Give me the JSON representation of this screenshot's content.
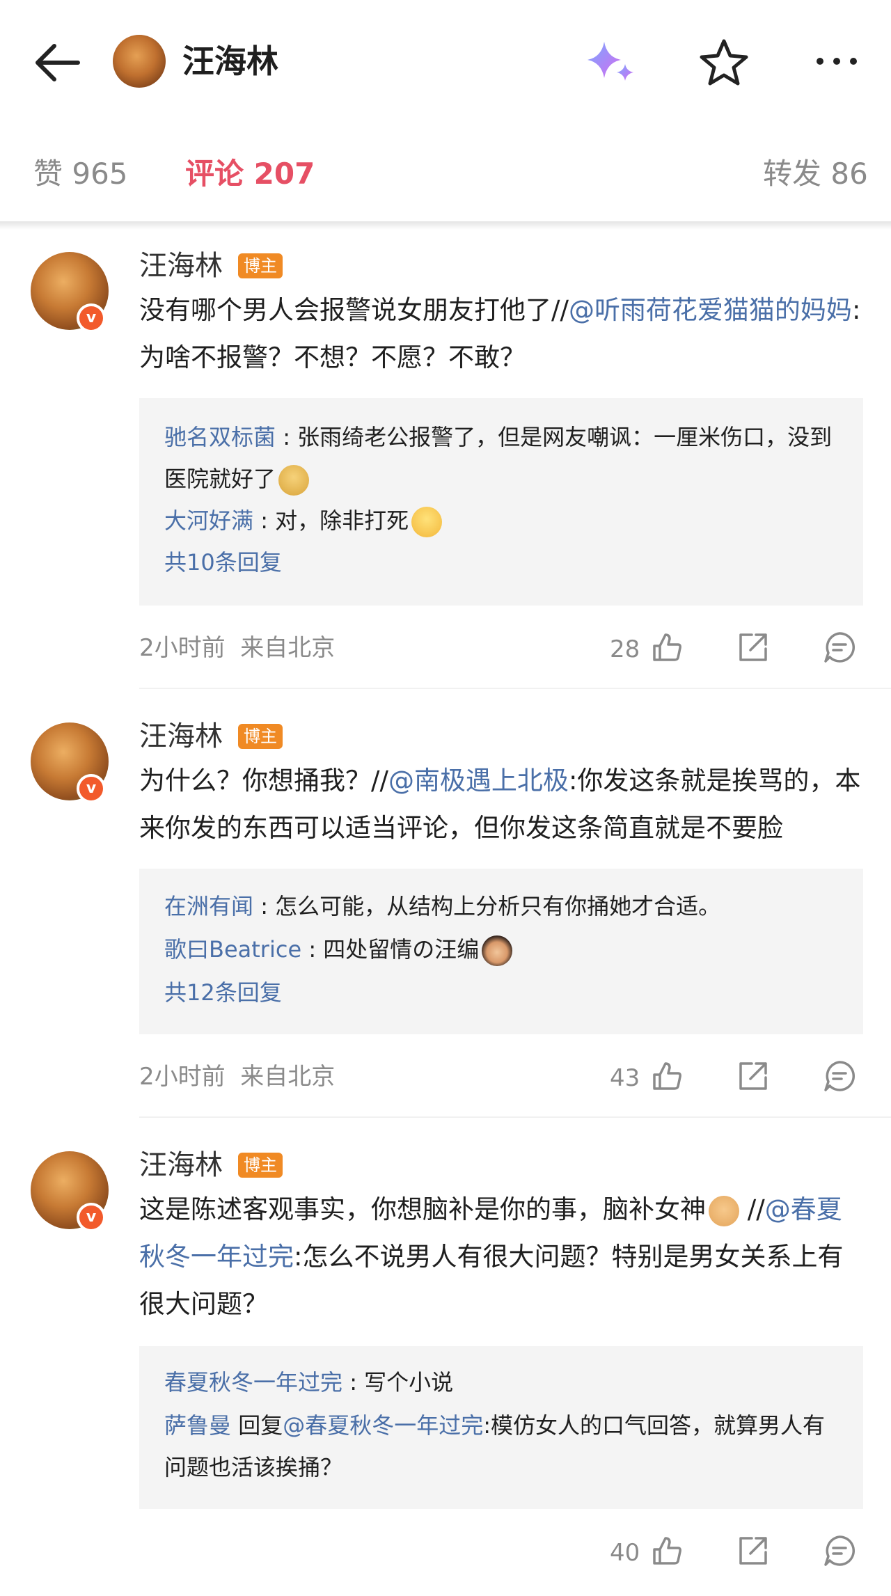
{
  "header": {
    "title": "汪海林"
  },
  "tabs": {
    "likes": "赞 965",
    "comments": "评论 207",
    "reposts": "转发 86"
  },
  "comments": [
    {
      "name": "汪海林",
      "badge": "博主",
      "text_a": "没有哪个男人会报警说女朋友打他了//",
      "mention": "@听雨荷花爱猫猫的妈妈",
      "text_b": ":为啥不报警？不想？不愿？不敢？",
      "replies": [
        {
          "name": "驰名双标菌",
          "sep": " : ",
          "text": "张雨绮老公报警了，但是网友嘲讽：一厘米伤口，没到医院就好了"
        },
        {
          "name": "大河好满",
          "sep": " : ",
          "text": "对，除非打死"
        }
      ],
      "more": "共10条回复",
      "time": "2小时前",
      "location": "来自北京",
      "likes": "28"
    },
    {
      "name": "汪海林",
      "badge": "博主",
      "text_a": "为什么？你想捅我？//",
      "mention": "@南极遇上北极",
      "text_b": ":你发这条就是挨骂的，本来你发的东西可以适当评论，但你发这条简直就是不要脸",
      "replies": [
        {
          "name": "在洲有闻",
          "sep": " : ",
          "text": "怎么可能，从结构上分析只有你捅她才合适。"
        },
        {
          "name": "歌曰Beatrice",
          "sep": " : ",
          "text": "四处留情の汪编"
        }
      ],
      "more": "共12条回复",
      "time": "2小时前",
      "location": "来自北京",
      "likes": "43"
    },
    {
      "name": "汪海林",
      "badge": "博主",
      "text_a": "这是陈述客观事实，你想脑补是你的事，脑补女神",
      "text_a2": " //",
      "mention": "@春夏秋冬一年过完",
      "text_b": ":怎么不说男人有很大问题？特别是男女关系上有很大问题？",
      "replies": [
        {
          "name": "春夏秋冬一年过完",
          "sep": " : ",
          "text": "写个小说"
        },
        {
          "name": "萨鲁曼",
          "reply_word": " 回复",
          "reply_to": "@春夏秋冬一年过完",
          "text": ":模仿女人的口气回答，就算男人有问题也活该挨捅？"
        }
      ],
      "likes": "40"
    }
  ],
  "icons": {
    "back": "arrow-left-icon",
    "sparkle": "sparkle-icon",
    "star": "star-icon",
    "more": "more-dots-icon",
    "like": "thumbs-up-icon",
    "share": "share-icon",
    "comment": "comment-icon"
  },
  "colors": {
    "active_tab": "#e64f64",
    "mention": "#4a6fa8",
    "badge": "#f08a24",
    "verified": "#f25a2b"
  }
}
